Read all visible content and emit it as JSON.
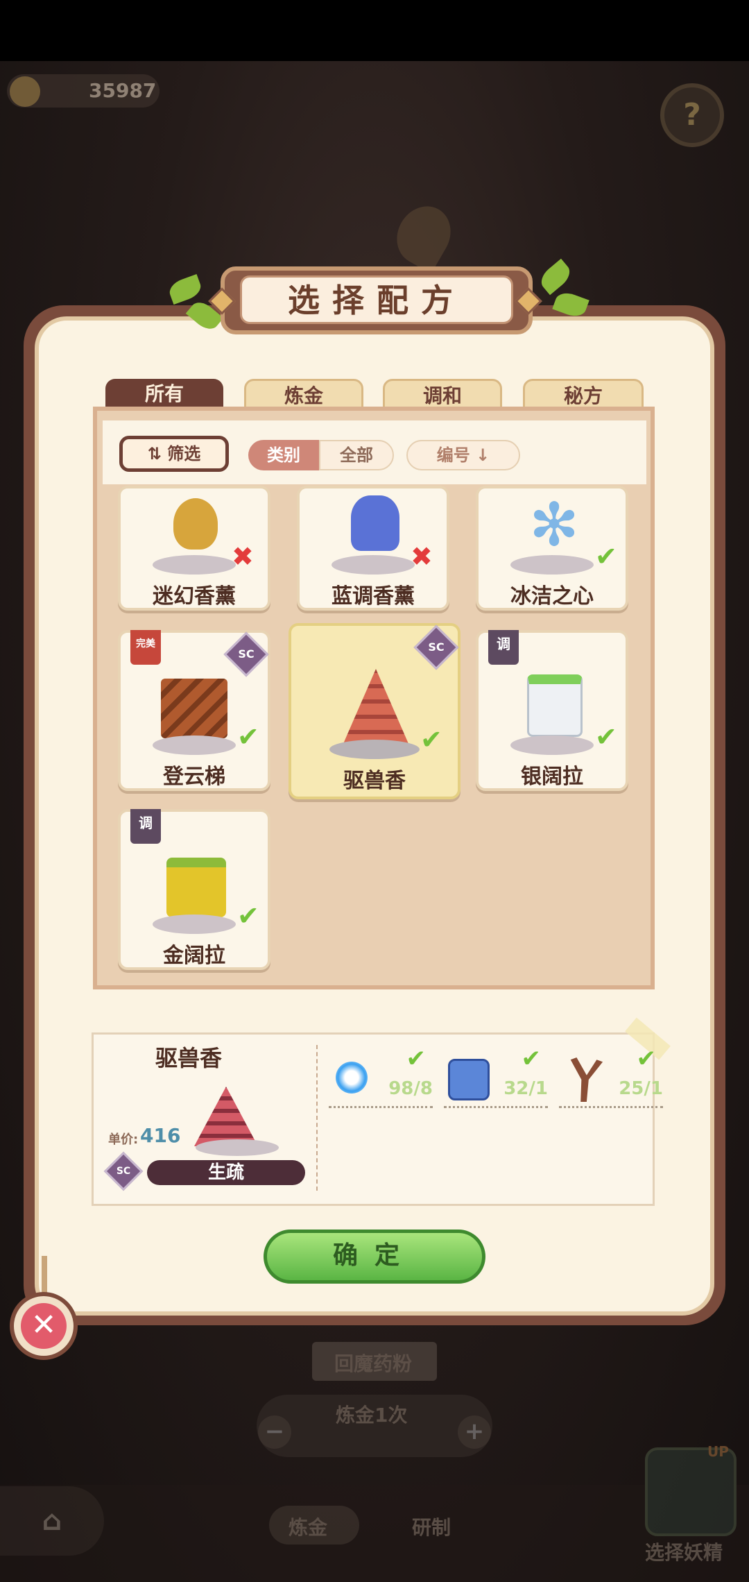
{
  "hud": {
    "coins": "35987",
    "help_label": "?"
  },
  "dialog": {
    "title": "选择配方",
    "tabs": [
      "所有",
      "炼金",
      "调和",
      "秘方"
    ],
    "active_tab": "所有",
    "filter_label": "筛选",
    "category_label": "类别",
    "category_value": "全部",
    "number_sort": "编号",
    "recipes": [
      {
        "name": "迷幻香薰",
        "status": "unavailable"
      },
      {
        "name": "蓝调香薰",
        "status": "unavailable"
      },
      {
        "name": "冰洁之心",
        "status": "available"
      },
      {
        "name": "登云梯",
        "status": "available",
        "tag": "完美",
        "badge": "SC"
      },
      {
        "name": "驱兽香",
        "status": "available",
        "badge": "SC",
        "selected": true
      },
      {
        "name": "银阔拉",
        "status": "available",
        "tag": "调"
      },
      {
        "name": "金阔拉",
        "status": "available",
        "tag": "调"
      }
    ],
    "detail": {
      "name": "驱兽香",
      "price_label": "单价:",
      "price": "416",
      "badge": "SC",
      "proficiency": "生疏",
      "ingredients": [
        {
          "icon": "blue-orb-icon",
          "qty": "98/8"
        },
        {
          "icon": "ice-cube-icon",
          "qty": "32/1"
        },
        {
          "icon": "branch-icon",
          "qty": "25/1"
        }
      ]
    },
    "confirm_label": "确定",
    "close_label": "✕"
  },
  "background": {
    "item_label": "回魔药粉",
    "alchemy_count": "炼金1次",
    "nav_tab_1": "炼金",
    "nav_tab_2": "研制",
    "spirit_label": "选择妖精",
    "up_badge": "UP",
    "home_icon": "⌂",
    "minus": "−",
    "plus": "+"
  },
  "colors": {
    "accent": "#6d3f34",
    "ok": "#74c23a",
    "no": "#e33b3b",
    "price": "#4e8ea9",
    "confirm": "#5ab544"
  }
}
